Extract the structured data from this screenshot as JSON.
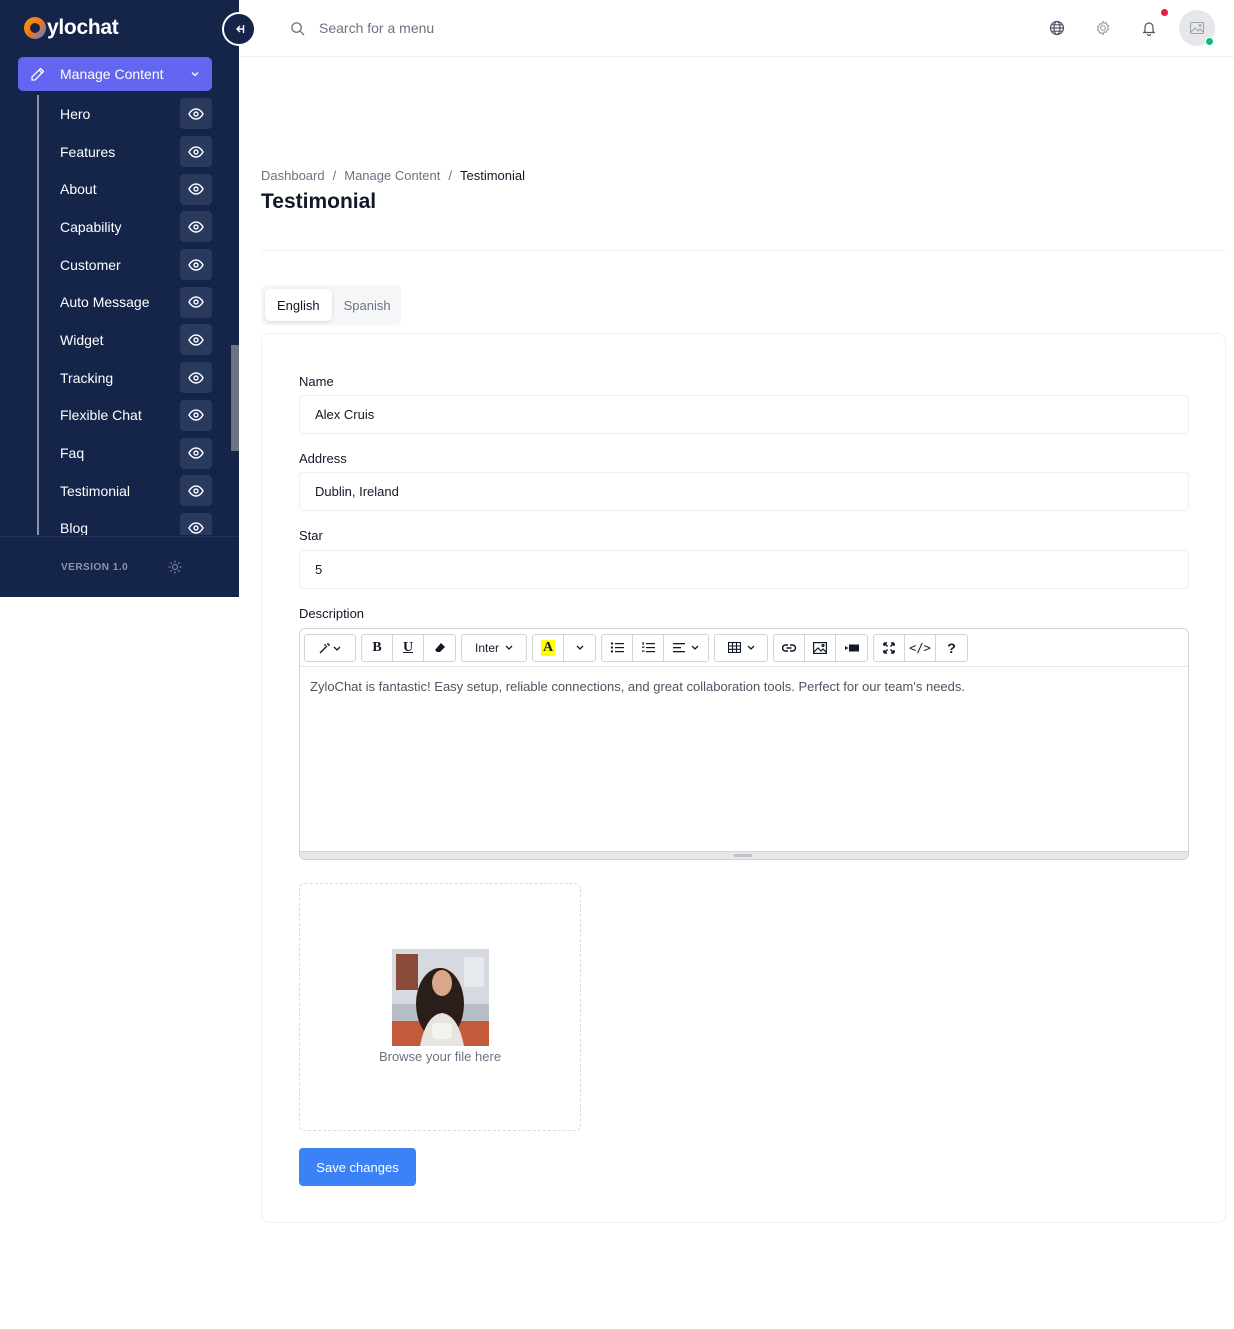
{
  "app": {
    "logo_text": "ylochat"
  },
  "sidebar": {
    "active_group": "Manage Content",
    "items": [
      {
        "label": "Hero"
      },
      {
        "label": "Features"
      },
      {
        "label": "About"
      },
      {
        "label": "Capability"
      },
      {
        "label": "Customer"
      },
      {
        "label": "Auto Message"
      },
      {
        "label": "Widget"
      },
      {
        "label": "Tracking"
      },
      {
        "label": "Flexible Chat"
      },
      {
        "label": "Faq"
      },
      {
        "label": "Testimonial"
      },
      {
        "label": "Blog"
      }
    ],
    "version": "VERSION 1.0"
  },
  "topbar": {
    "search_placeholder": "Search for a menu"
  },
  "breadcrumb": {
    "items": [
      "Dashboard",
      "Manage Content",
      "Testimonial"
    ]
  },
  "page": {
    "title": "Testimonial"
  },
  "tabs": [
    {
      "label": "English",
      "active": true
    },
    {
      "label": "Spanish",
      "active": false
    }
  ],
  "form": {
    "name_label": "Name",
    "name_value": "Alex Cruis",
    "address_label": "Address",
    "address_value": "Dublin, Ireland",
    "star_label": "Star",
    "star_value": "5",
    "description_label": "Description",
    "description_value": "ZyloChat is fantastic! Easy setup, reliable connections, and great collaboration tools. Perfect for our team's needs.",
    "font_select": "Inter",
    "upload_text": "Browse your file here",
    "save_label": "Save changes"
  },
  "colors": {
    "sidebar_bg": "#15254a",
    "accent": "#6366f1",
    "primary_button": "#3b82f6",
    "notification": "#e11d48",
    "online": "#10b981"
  }
}
